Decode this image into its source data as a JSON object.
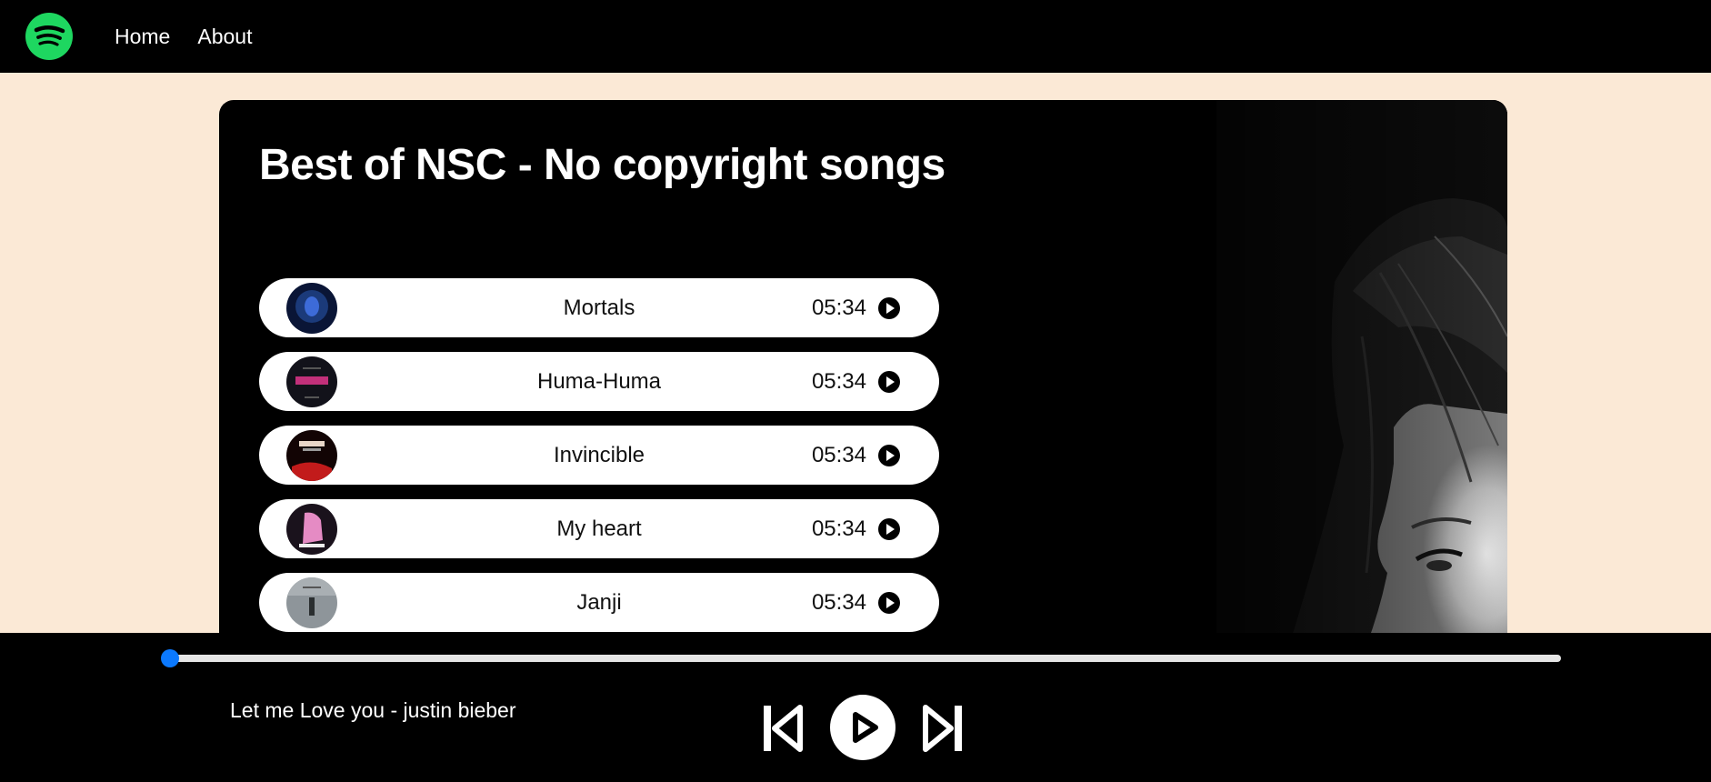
{
  "navbar": {
    "logo_icon": "spotify-logo-icon",
    "links": [
      {
        "label": "Home"
      },
      {
        "label": "About"
      }
    ]
  },
  "playlist": {
    "title": "Best of NSC - No copyright songs",
    "songs": [
      {
        "name": "Mortals",
        "duration": "05:34",
        "cover_colors": [
          "#1B3A7A",
          "#0A1536",
          "#3D6BD8"
        ]
      },
      {
        "name": "Huma-Huma",
        "duration": "05:34",
        "cover_colors": [
          "#1A1A26",
          "#0C0C12",
          "#C2307A"
        ]
      },
      {
        "name": "Invincible",
        "duration": "05:34",
        "cover_colors": [
          "#2A0A0A",
          "#120404",
          "#C21B1B"
        ]
      },
      {
        "name": "My heart",
        "duration": "05:34",
        "cover_colors": [
          "#3A2A3A",
          "#1A121C",
          "#E58BC4"
        ]
      },
      {
        "name": "Janji",
        "duration": "05:34",
        "cover_colors": [
          "#8E959A",
          "#5C6266",
          "#2A2E30"
        ]
      }
    ]
  },
  "player": {
    "now_playing": "Let me Love you - justin bieber",
    "progress": 0.0,
    "colors": {
      "accent": "#0B79FF"
    },
    "controls": [
      "previous-icon",
      "play-icon",
      "next-icon"
    ]
  }
}
